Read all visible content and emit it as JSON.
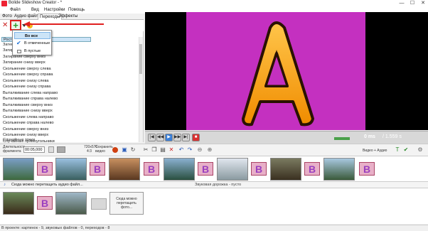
{
  "window": {
    "title": "Bolide Slideshow Creator - *",
    "minimize": "—",
    "maximize": "☐",
    "close": "✕"
  },
  "menu": [
    "Файл",
    "Вид",
    "Настройки",
    "Помощь"
  ],
  "tabs": [
    {
      "label": "Фото",
      "active": false
    },
    {
      "label": "Аудио файлы",
      "active": false
    },
    {
      "label": "Переходы",
      "active": true
    },
    {
      "label": "Эффекты",
      "active": false
    }
  ],
  "popup": {
    "items": [
      {
        "label": "Во все",
        "highlighted": true,
        "checked": false
      },
      {
        "label": "В отмеченные",
        "highlighted": false,
        "checked": true
      },
      {
        "label": "В пустые",
        "highlighted": false,
        "checked": false
      }
    ]
  },
  "transitions": {
    "selected_partial": "Росте",
    "items": [
      "Затенение ...",
      "Затирание ...",
      "Затирание сверху вниз",
      "Затирание снизу вверх",
      "Скольжение сверху слева",
      "Скольжение сверху справа",
      "Скольжение снизу слева",
      "Скольжение снизу справа",
      "Выталкивание слева направо",
      "Выталкивание справа налево",
      "Выталкивание сверху вниз",
      "Выталкивание снизу вверх",
      "Скольжение слева направо",
      "Скольжение справа налево",
      "Скольжение сверху вниз",
      "Скольжение снизу вверх",
      "Случайные точки",
      "Случайные прямоугольники"
    ]
  },
  "preview": {
    "letter": "A",
    "stage_color": "#c430c0",
    "letter_color": "#f5a623"
  },
  "player": {
    "time": "0 ms",
    "duration": "/ 1.559 s"
  },
  "timeline_toolbar": {
    "duration_label": "Длительность фрагмента",
    "duration_value": "00:05,000",
    "resolution": "720x576",
    "aspect": "4:3",
    "save_video": "Сохранить видео",
    "video_plus_audio": "Видео + Аудио"
  },
  "timeline": {
    "transition_letter": "B",
    "audio_hint": "Сюда можно перетащить аудио файл...",
    "audio_track": "Звуковая дорожка - пусто",
    "drop_hint": "Сюда можно перетащить фото..."
  },
  "status": "В проекте: картинок - 9, звуковых файлов - 0, переходов - 8",
  "colors": {
    "accent_red": "#e02020",
    "popup_highlight": "#cce4f7",
    "check_blue": "#1a6fd6"
  }
}
